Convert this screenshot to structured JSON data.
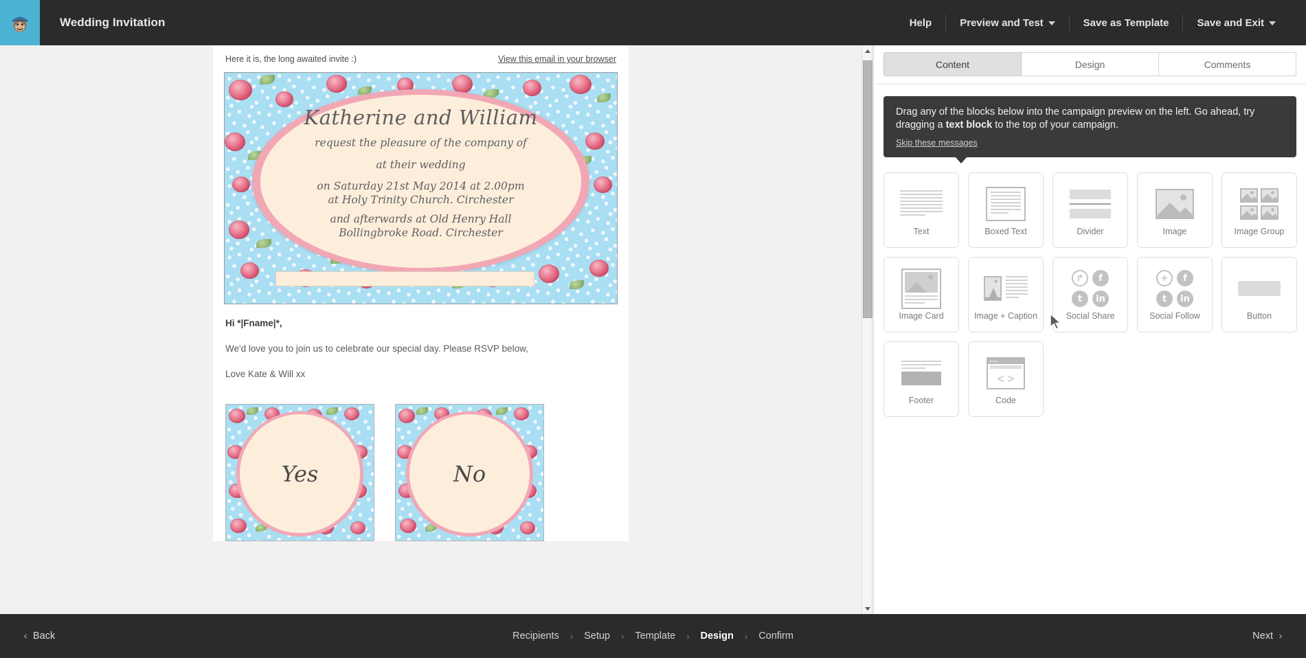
{
  "topbar": {
    "logo_icon": "mailchimp-monkey-icon",
    "campaign_title": "Wedding Invitation",
    "help_label": "Help",
    "preview_and_test_label": "Preview and Test",
    "save_as_template_label": "Save as Template",
    "save_and_exit_label": "Save and Exit"
  },
  "preview": {
    "preheader_text": "Here it is, the long awaited invite :)",
    "view_in_browser_label": "View this email in your browser",
    "invitation": {
      "names": "Katherine and William",
      "line1": "request the pleasure of the company of",
      "line2": "at their wedding",
      "line3": "on Saturday  21st May 2014  at 2.00pm",
      "line4": "at Holy Trinity Church. Circhester",
      "line5": "and afterwards at Old Henry Hall",
      "line6": "Bollingbroke Road. Circhester"
    },
    "greeting": "Hi *|Fname|*,",
    "paragraph": "We'd love you to join us to celebrate our special day. Please RSVP below,",
    "signoff": "Love Kate & Will xx",
    "rsvp_yes": "Yes",
    "rsvp_no": "No"
  },
  "panel": {
    "tabs": [
      {
        "label": "Content",
        "active": true
      },
      {
        "label": "Design",
        "active": false
      },
      {
        "label": "Comments",
        "active": false
      }
    ],
    "tooltip": {
      "text_part1": "Drag any of the blocks below into the campaign preview on the left. Go ahead, try dragging a ",
      "text_bold": "text block",
      "text_part2": " to the top of your campaign.",
      "skip_label": "Skip these messages"
    },
    "blocks": [
      {
        "label": "Text",
        "icon": "text-lines-icon"
      },
      {
        "label": "Boxed Text",
        "icon": "boxed-text-icon"
      },
      {
        "label": "Divider",
        "icon": "divider-icon"
      },
      {
        "label": "Image",
        "icon": "image-icon"
      },
      {
        "label": "Image Group",
        "icon": "image-group-icon"
      },
      {
        "label": "Image Card",
        "icon": "image-card-icon"
      },
      {
        "label": "Image + Caption",
        "icon": "image-caption-icon"
      },
      {
        "label": "Social Share",
        "icon": "social-share-icon"
      },
      {
        "label": "Social Follow",
        "icon": "social-follow-icon"
      },
      {
        "label": "Button",
        "icon": "button-icon"
      },
      {
        "label": "Footer",
        "icon": "footer-icon"
      },
      {
        "label": "Code",
        "icon": "code-icon"
      }
    ]
  },
  "bottombar": {
    "back_label": "Back",
    "next_label": "Next",
    "steps": [
      {
        "label": "Recipients",
        "active": false
      },
      {
        "label": "Setup",
        "active": false
      },
      {
        "label": "Template",
        "active": false
      },
      {
        "label": "Design",
        "active": true
      },
      {
        "label": "Confirm",
        "active": false
      }
    ]
  },
  "colors": {
    "brand_cyan": "#4cb3d4",
    "chrome_dark": "#2b2b2b",
    "tooltip_dark": "#3a3a3a",
    "floral_blue": "#a9def3",
    "rose_pink": "#f2a7b5",
    "cream": "#fdeedc"
  }
}
